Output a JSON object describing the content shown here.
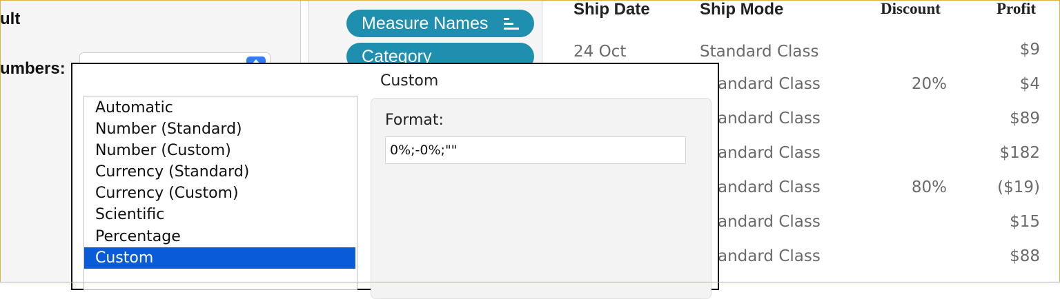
{
  "left_pane": {
    "heading": "ult",
    "numbers_label": "umbers:"
  },
  "shelf": {
    "pills": [
      "Measure Names",
      "Category"
    ],
    "icon": "sort-bars-icon"
  },
  "table": {
    "headers": {
      "ship_date": "Ship Date",
      "ship_mode": "Ship Mode",
      "discount": "Discount",
      "profit": "Profit"
    },
    "first_date": "24 Oct",
    "rows": [
      {
        "ship_mode": "Standard Class",
        "discount": "",
        "profit": "$9"
      },
      {
        "ship_mode": "andard Class",
        "discount": "20%",
        "profit": "$4"
      },
      {
        "ship_mode": "andard Class",
        "discount": "",
        "profit": "$89"
      },
      {
        "ship_mode": "andard Class",
        "discount": "",
        "profit": "$182"
      },
      {
        "ship_mode": "andard Class",
        "discount": "80%",
        "profit": "($19)"
      },
      {
        "ship_mode": "andard Class",
        "discount": "",
        "profit": "$15"
      },
      {
        "ship_mode": "andard Class",
        "discount": "",
        "profit": "$88"
      }
    ]
  },
  "dialog": {
    "title": "Custom",
    "format_label": "Format:",
    "format_value": "0%;-0%;\"\"",
    "number_formats": [
      "Automatic",
      "Number (Standard)",
      "Number (Custom)",
      "Currency (Standard)",
      "Currency (Custom)",
      "Scientific",
      "Percentage",
      "Custom"
    ],
    "selected_format": "Custom"
  },
  "colors": {
    "pill": "#1f8fb0",
    "selection": "#0a5bd8",
    "frame": "#e0b437"
  }
}
